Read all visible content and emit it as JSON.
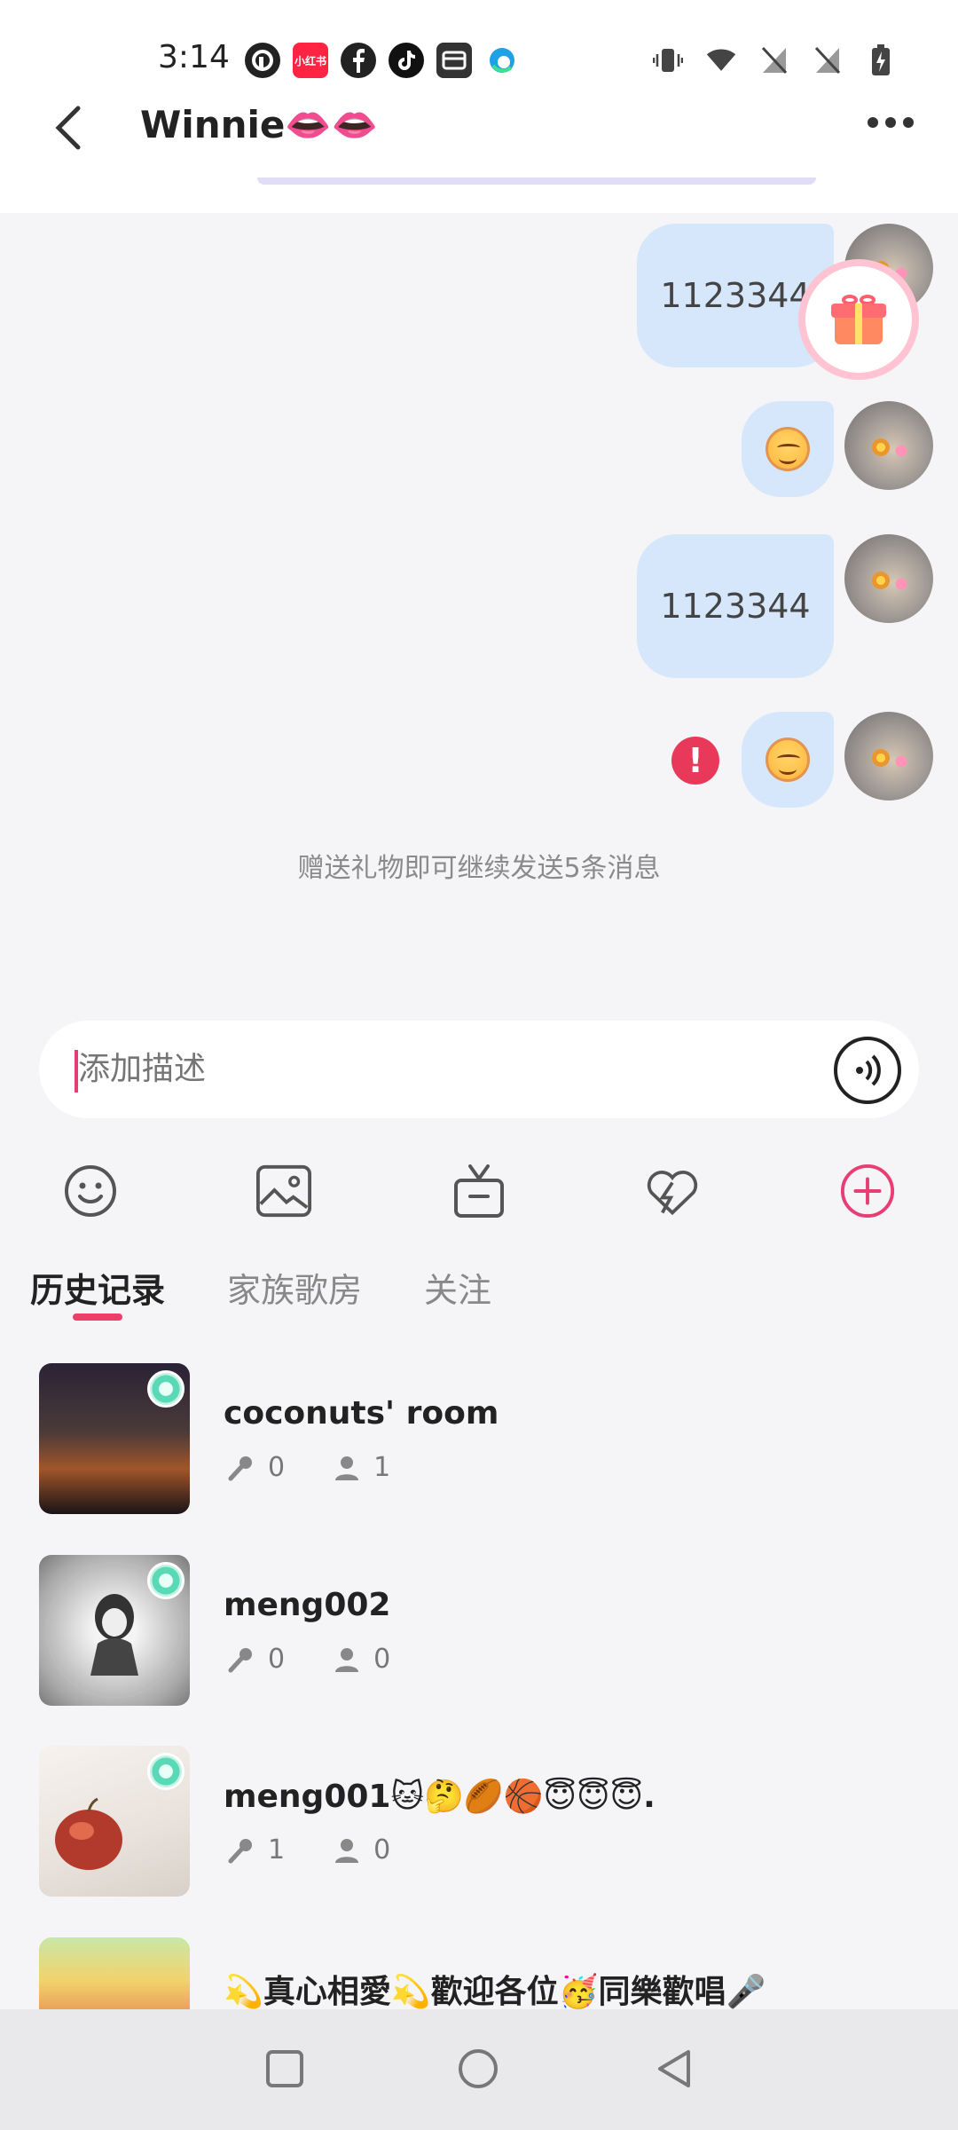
{
  "status_bar": {
    "time": "3:14",
    "left_icons": [
      "pocket-casts-icon",
      "xiaohongshu-icon",
      "facebook-icon",
      "tiktok-icon",
      "wallet-icon",
      "edge-icon"
    ],
    "xiaohongshu_label": "小红书",
    "right_icons": [
      "vibrate-icon",
      "wifi-icon",
      "no-sim-1-icon",
      "no-sim-2-icon",
      "battery-charging-icon"
    ]
  },
  "header": {
    "title": "Winnie👄👄",
    "more_icon": "more-horizontal-icon"
  },
  "messages": [
    {
      "type": "text",
      "text": "1123344",
      "has_gift_badge": true
    },
    {
      "type": "emoji",
      "emoji": "blush-face"
    },
    {
      "type": "text",
      "text": "1123344"
    },
    {
      "type": "emoji",
      "emoji": "blush-face",
      "error": "!"
    }
  ],
  "notice": "赠送礼物即可继续发送5条消息",
  "input": {
    "placeholder": "添加描述",
    "voice_icon": "voice-wave-icon"
  },
  "toolbar": {
    "items": [
      "emoji-icon",
      "image-icon",
      "gift-icon",
      "heart-icon",
      "add-icon"
    ],
    "accent": "#e83e74"
  },
  "tabs": [
    {
      "label": "历史记录",
      "active": true
    },
    {
      "label": "家族歌房",
      "active": false
    },
    {
      "label": "关注",
      "active": false
    }
  ],
  "rooms": [
    {
      "name": "coconuts' room",
      "mics": "0",
      "people": "1"
    },
    {
      "name": "meng002",
      "mics": "0",
      "people": "0"
    },
    {
      "name": "meng001🐱🤔🏉🏀😇😇😇.",
      "mics": "1",
      "people": "0"
    },
    {
      "name": "💫真心相愛💫歡迎各位🥳同樂歡唱🎤"
    }
  ],
  "nav": [
    "recent-apps-icon",
    "home-icon",
    "back-icon"
  ]
}
